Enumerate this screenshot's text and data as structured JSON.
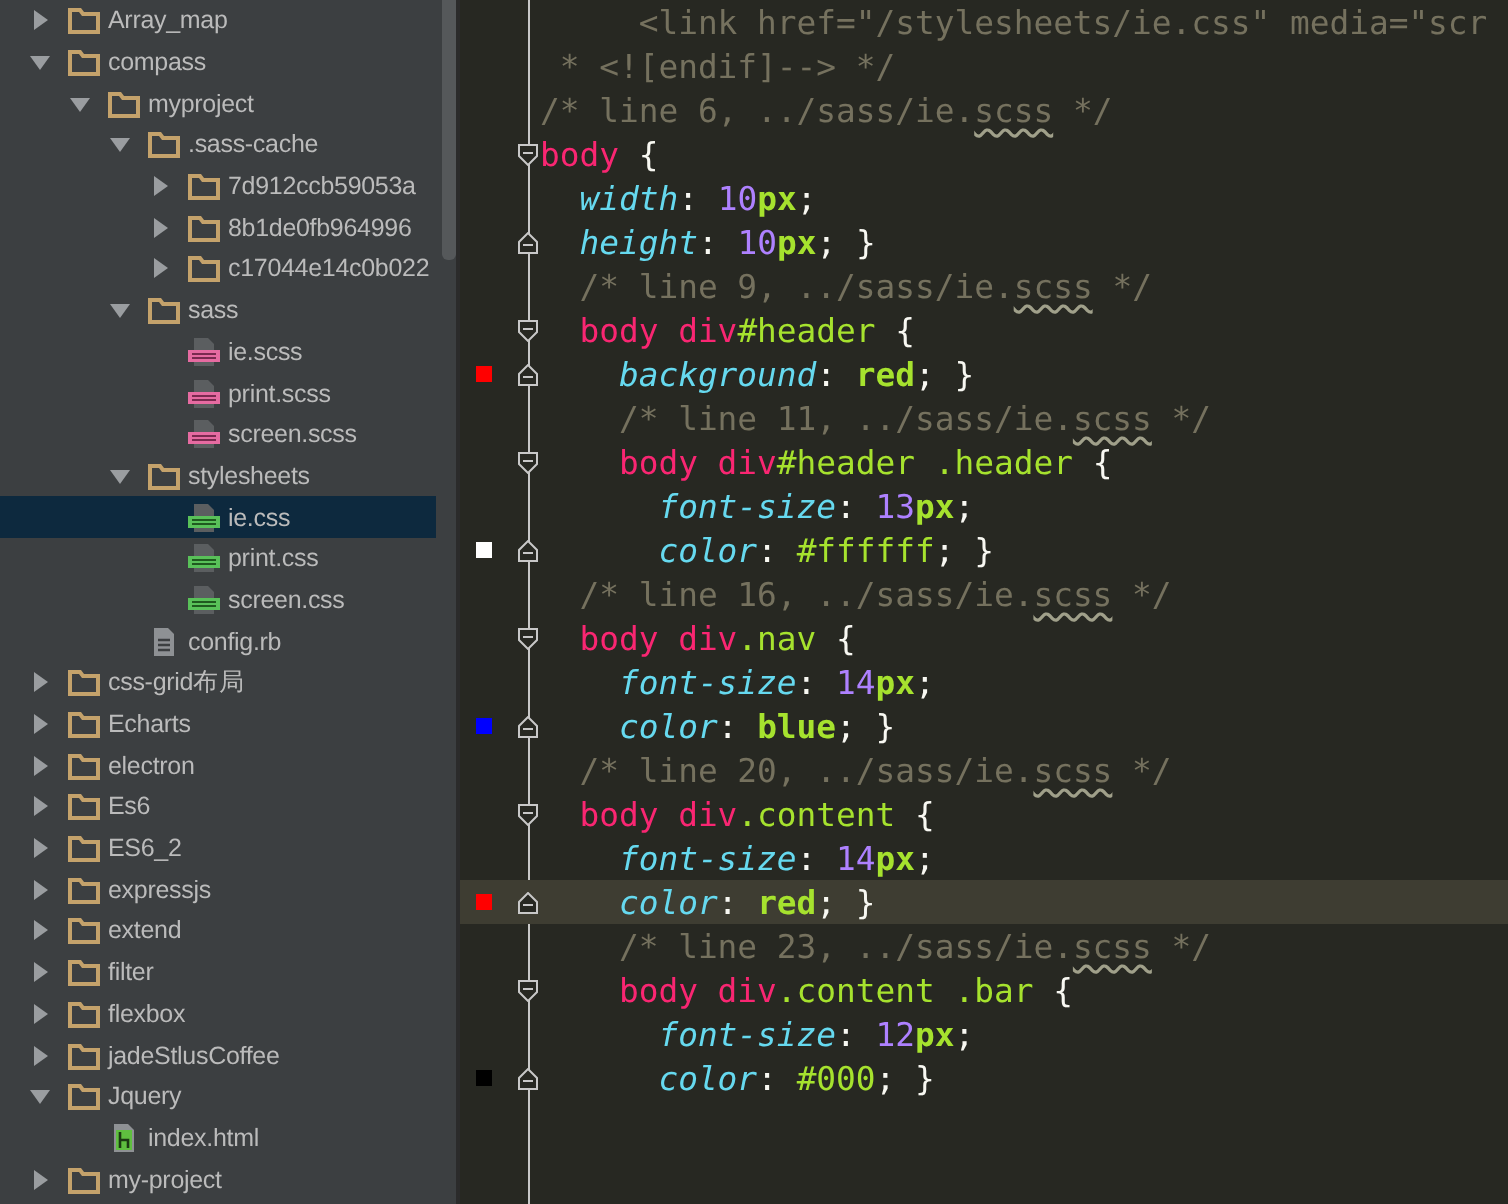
{
  "project_tree": [
    {
      "label": "Array_map",
      "kind": "folder",
      "expanded": false,
      "selected": false
    },
    {
      "label": "compass",
      "kind": "folder",
      "expanded": true,
      "selected": false,
      "children": [
        {
          "label": "myproject",
          "kind": "folder",
          "expanded": true,
          "selected": false,
          "children": [
            {
              "label": ".sass-cache",
              "kind": "folder",
              "expanded": true,
              "selected": false,
              "children": [
                {
                  "label": "7d912ccb59053a",
                  "kind": "folder",
                  "expanded": false,
                  "selected": false
                },
                {
                  "label": "8b1de0fb964996",
                  "kind": "folder",
                  "expanded": false,
                  "selected": false
                },
                {
                  "label": "c17044e14c0b022",
                  "kind": "folder",
                  "expanded": false,
                  "selected": false
                }
              ]
            },
            {
              "label": "sass",
              "kind": "folder",
              "expanded": true,
              "selected": false,
              "children": [
                {
                  "label": "ie.scss",
                  "kind": "sass",
                  "selected": false
                },
                {
                  "label": "print.scss",
                  "kind": "sass",
                  "selected": false
                },
                {
                  "label": "screen.scss",
                  "kind": "sass",
                  "selected": false
                }
              ]
            },
            {
              "label": "stylesheets",
              "kind": "folder",
              "expanded": true,
              "selected": false,
              "children": [
                {
                  "label": "ie.css",
                  "kind": "css",
                  "selected": true
                },
                {
                  "label": "print.css",
                  "kind": "css",
                  "selected": false
                },
                {
                  "label": "screen.css",
                  "kind": "css",
                  "selected": false
                }
              ]
            },
            {
              "label": "config.rb",
              "kind": "text",
              "selected": false
            }
          ]
        }
      ]
    },
    {
      "label": "css-grid布局",
      "kind": "folder",
      "expanded": false,
      "selected": false
    },
    {
      "label": "Echarts",
      "kind": "folder",
      "expanded": false,
      "selected": false
    },
    {
      "label": "electron",
      "kind": "folder",
      "expanded": false,
      "selected": false
    },
    {
      "label": "Es6",
      "kind": "folder",
      "expanded": false,
      "selected": false
    },
    {
      "label": "ES6_2",
      "kind": "folder",
      "expanded": false,
      "selected": false
    },
    {
      "label": "expressjs",
      "kind": "folder",
      "expanded": false,
      "selected": false
    },
    {
      "label": "extend",
      "kind": "folder",
      "expanded": false,
      "selected": false
    },
    {
      "label": "filter",
      "kind": "folder",
      "expanded": false,
      "selected": false
    },
    {
      "label": "flexbox",
      "kind": "folder",
      "expanded": false,
      "selected": false
    },
    {
      "label": "jadeStlusCoffee",
      "kind": "folder",
      "expanded": false,
      "selected": false
    },
    {
      "label": "Jquery",
      "kind": "folder",
      "expanded": true,
      "selected": false,
      "children": [
        {
          "label": "index.html",
          "kind": "html",
          "selected": false
        }
      ]
    },
    {
      "label": "my-project",
      "kind": "folder",
      "expanded": false,
      "selected": false
    }
  ],
  "editor": {
    "lines": [
      {
        "kind": "code",
        "current": false,
        "tokens": [
          {
            "kind": "comment",
            "text": "     <link href=\"/stylesheets/ie.css\" media=\"scr"
          }
        ]
      },
      {
        "kind": "code",
        "current": false,
        "tokens": [
          {
            "kind": "comment",
            "text": " * <![endif]--> */"
          }
        ]
      },
      {
        "kind": "code",
        "current": false,
        "tokens": [
          {
            "kind": "comment",
            "text": "/* line 6, ../sass/ie."
          },
          {
            "kind": "misspelled",
            "text": "scss"
          },
          {
            "kind": "comment",
            "text": " */"
          }
        ]
      },
      {
        "kind": "opener",
        "current": false,
        "tokens": [
          {
            "kind": "tag",
            "text": "body"
          },
          {
            "kind": "plain",
            "text": " {"
          }
        ]
      },
      {
        "kind": "code",
        "current": false,
        "tokens": [
          {
            "kind": "property",
            "text": "  width"
          },
          {
            "kind": "plain",
            "text": ": "
          },
          {
            "kind": "number",
            "text": "10"
          },
          {
            "kind": "unit",
            "text": "px"
          },
          {
            "kind": "plain",
            "text": ";"
          }
        ]
      },
      {
        "kind": "closer",
        "current": false,
        "tokens": [
          {
            "kind": "property",
            "text": "  height"
          },
          {
            "kind": "plain",
            "text": ": "
          },
          {
            "kind": "number",
            "text": "10"
          },
          {
            "kind": "unit",
            "text": "px"
          },
          {
            "kind": "plain",
            "text": "; }"
          }
        ]
      },
      {
        "kind": "code",
        "current": false,
        "tokens": [
          {
            "kind": "comment",
            "text": "  /* line 9, ../sass/ie."
          },
          {
            "kind": "misspelled",
            "text": "scss"
          },
          {
            "kind": "comment",
            "text": " */"
          }
        ]
      },
      {
        "kind": "opener",
        "current": false,
        "tokens": [
          {
            "kind": "tag",
            "text": "  body div"
          },
          {
            "kind": "selector",
            "text": "#header"
          },
          {
            "kind": "plain",
            "text": " {"
          }
        ]
      },
      {
        "kind": "closer",
        "current": false,
        "color": "#ff0000",
        "tokens": [
          {
            "kind": "property",
            "text": "    background"
          },
          {
            "kind": "plain",
            "text": ": "
          },
          {
            "kind": "value",
            "text": "red"
          },
          {
            "kind": "plain",
            "text": "; }"
          }
        ]
      },
      {
        "kind": "code",
        "current": false,
        "tokens": [
          {
            "kind": "comment",
            "text": "    /* line 11, ../sass/ie."
          },
          {
            "kind": "misspelled",
            "text": "scss"
          },
          {
            "kind": "comment",
            "text": " */"
          }
        ]
      },
      {
        "kind": "opener",
        "current": false,
        "tokens": [
          {
            "kind": "tag",
            "text": "    body div"
          },
          {
            "kind": "selector",
            "text": "#header"
          },
          {
            "kind": "selector",
            "text": " .header"
          },
          {
            "kind": "plain",
            "text": " {"
          }
        ]
      },
      {
        "kind": "code",
        "current": false,
        "tokens": [
          {
            "kind": "property",
            "text": "      font-size"
          },
          {
            "kind": "plain",
            "text": ": "
          },
          {
            "kind": "number",
            "text": "13"
          },
          {
            "kind": "unit",
            "text": "px"
          },
          {
            "kind": "plain",
            "text": ";"
          }
        ]
      },
      {
        "kind": "closer",
        "current": false,
        "color": "#ffffff",
        "tokens": [
          {
            "kind": "property",
            "text": "      color"
          },
          {
            "kind": "plain",
            "text": ": "
          },
          {
            "kind": "selector",
            "text": "#ffffff"
          },
          {
            "kind": "plain",
            "text": "; }"
          }
        ]
      },
      {
        "kind": "code",
        "current": false,
        "tokens": [
          {
            "kind": "comment",
            "text": "  /* line 16, ../sass/ie."
          },
          {
            "kind": "misspelled",
            "text": "scss"
          },
          {
            "kind": "comment",
            "text": " */"
          }
        ]
      },
      {
        "kind": "opener",
        "current": false,
        "tokens": [
          {
            "kind": "tag",
            "text": "  body div"
          },
          {
            "kind": "selector",
            "text": ".nav"
          },
          {
            "kind": "plain",
            "text": " {"
          }
        ]
      },
      {
        "kind": "code",
        "current": false,
        "tokens": [
          {
            "kind": "property",
            "text": "    font-size"
          },
          {
            "kind": "plain",
            "text": ": "
          },
          {
            "kind": "number",
            "text": "14"
          },
          {
            "kind": "unit",
            "text": "px"
          },
          {
            "kind": "plain",
            "text": ";"
          }
        ]
      },
      {
        "kind": "closer",
        "current": false,
        "color": "#0000ff",
        "tokens": [
          {
            "kind": "property",
            "text": "    color"
          },
          {
            "kind": "plain",
            "text": ": "
          },
          {
            "kind": "value",
            "text": "blue"
          },
          {
            "kind": "plain",
            "text": "; }"
          }
        ]
      },
      {
        "kind": "code",
        "current": false,
        "tokens": [
          {
            "kind": "comment",
            "text": "  /* line 20, ../sass/ie."
          },
          {
            "kind": "misspelled",
            "text": "scss"
          },
          {
            "kind": "comment",
            "text": " */"
          }
        ]
      },
      {
        "kind": "opener",
        "current": false,
        "tokens": [
          {
            "kind": "tag",
            "text": "  body div"
          },
          {
            "kind": "selector",
            "text": ".content"
          },
          {
            "kind": "plain",
            "text": " {"
          }
        ]
      },
      {
        "kind": "code",
        "current": false,
        "tokens": [
          {
            "kind": "property",
            "text": "    font-size"
          },
          {
            "kind": "plain",
            "text": ": "
          },
          {
            "kind": "number",
            "text": "14"
          },
          {
            "kind": "unit",
            "text": "px"
          },
          {
            "kind": "plain",
            "text": ";"
          }
        ]
      },
      {
        "kind": "closer",
        "current": true,
        "color": "#ff0000",
        "tokens": [
          {
            "kind": "property",
            "text": "    color"
          },
          {
            "kind": "plain",
            "text": ": "
          },
          {
            "kind": "value",
            "text": "red"
          },
          {
            "kind": "plain",
            "text": "; }"
          }
        ]
      },
      {
        "kind": "code",
        "current": false,
        "tokens": [
          {
            "kind": "comment",
            "text": "    /* line 23, ../sass/ie."
          },
          {
            "kind": "misspelled",
            "text": "scss"
          },
          {
            "kind": "comment",
            "text": " */"
          }
        ]
      },
      {
        "kind": "opener",
        "current": false,
        "tokens": [
          {
            "kind": "tag",
            "text": "    body div"
          },
          {
            "kind": "selector",
            "text": ".content"
          },
          {
            "kind": "selector",
            "text": " .bar"
          },
          {
            "kind": "plain",
            "text": " {"
          }
        ]
      },
      {
        "kind": "code",
        "current": false,
        "tokens": [
          {
            "kind": "property",
            "text": "      font-size"
          },
          {
            "kind": "plain",
            "text": ": "
          },
          {
            "kind": "number",
            "text": "12"
          },
          {
            "kind": "unit",
            "text": "px"
          },
          {
            "kind": "plain",
            "text": ";"
          }
        ]
      },
      {
        "kind": "closer",
        "current": false,
        "color": "#000000",
        "tokens": [
          {
            "kind": "property",
            "text": "      color"
          },
          {
            "kind": "plain",
            "text": ": "
          },
          {
            "kind": "selector",
            "text": "#000"
          },
          {
            "kind": "plain",
            "text": "; }"
          }
        ]
      }
    ]
  }
}
